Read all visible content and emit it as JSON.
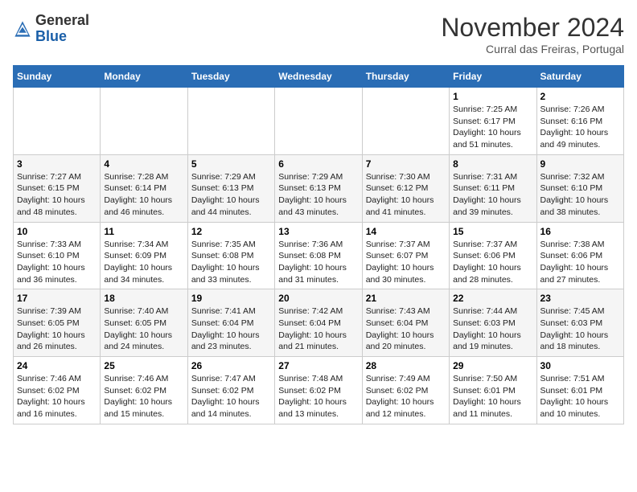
{
  "logo": {
    "general": "General",
    "blue": "Blue"
  },
  "header": {
    "month": "November 2024",
    "location": "Curral das Freiras, Portugal"
  },
  "weekdays": [
    "Sunday",
    "Monday",
    "Tuesday",
    "Wednesday",
    "Thursday",
    "Friday",
    "Saturday"
  ],
  "weeks": [
    [
      {
        "day": "",
        "info": ""
      },
      {
        "day": "",
        "info": ""
      },
      {
        "day": "",
        "info": ""
      },
      {
        "day": "",
        "info": ""
      },
      {
        "day": "",
        "info": ""
      },
      {
        "day": "1",
        "info": "Sunrise: 7:25 AM\nSunset: 6:17 PM\nDaylight: 10 hours\nand 51 minutes."
      },
      {
        "day": "2",
        "info": "Sunrise: 7:26 AM\nSunset: 6:16 PM\nDaylight: 10 hours\nand 49 minutes."
      }
    ],
    [
      {
        "day": "3",
        "info": "Sunrise: 7:27 AM\nSunset: 6:15 PM\nDaylight: 10 hours\nand 48 minutes."
      },
      {
        "day": "4",
        "info": "Sunrise: 7:28 AM\nSunset: 6:14 PM\nDaylight: 10 hours\nand 46 minutes."
      },
      {
        "day": "5",
        "info": "Sunrise: 7:29 AM\nSunset: 6:13 PM\nDaylight: 10 hours\nand 44 minutes."
      },
      {
        "day": "6",
        "info": "Sunrise: 7:29 AM\nSunset: 6:13 PM\nDaylight: 10 hours\nand 43 minutes."
      },
      {
        "day": "7",
        "info": "Sunrise: 7:30 AM\nSunset: 6:12 PM\nDaylight: 10 hours\nand 41 minutes."
      },
      {
        "day": "8",
        "info": "Sunrise: 7:31 AM\nSunset: 6:11 PM\nDaylight: 10 hours\nand 39 minutes."
      },
      {
        "day": "9",
        "info": "Sunrise: 7:32 AM\nSunset: 6:10 PM\nDaylight: 10 hours\nand 38 minutes."
      }
    ],
    [
      {
        "day": "10",
        "info": "Sunrise: 7:33 AM\nSunset: 6:10 PM\nDaylight: 10 hours\nand 36 minutes."
      },
      {
        "day": "11",
        "info": "Sunrise: 7:34 AM\nSunset: 6:09 PM\nDaylight: 10 hours\nand 34 minutes."
      },
      {
        "day": "12",
        "info": "Sunrise: 7:35 AM\nSunset: 6:08 PM\nDaylight: 10 hours\nand 33 minutes."
      },
      {
        "day": "13",
        "info": "Sunrise: 7:36 AM\nSunset: 6:08 PM\nDaylight: 10 hours\nand 31 minutes."
      },
      {
        "day": "14",
        "info": "Sunrise: 7:37 AM\nSunset: 6:07 PM\nDaylight: 10 hours\nand 30 minutes."
      },
      {
        "day": "15",
        "info": "Sunrise: 7:37 AM\nSunset: 6:06 PM\nDaylight: 10 hours\nand 28 minutes."
      },
      {
        "day": "16",
        "info": "Sunrise: 7:38 AM\nSunset: 6:06 PM\nDaylight: 10 hours\nand 27 minutes."
      }
    ],
    [
      {
        "day": "17",
        "info": "Sunrise: 7:39 AM\nSunset: 6:05 PM\nDaylight: 10 hours\nand 26 minutes."
      },
      {
        "day": "18",
        "info": "Sunrise: 7:40 AM\nSunset: 6:05 PM\nDaylight: 10 hours\nand 24 minutes."
      },
      {
        "day": "19",
        "info": "Sunrise: 7:41 AM\nSunset: 6:04 PM\nDaylight: 10 hours\nand 23 minutes."
      },
      {
        "day": "20",
        "info": "Sunrise: 7:42 AM\nSunset: 6:04 PM\nDaylight: 10 hours\nand 21 minutes."
      },
      {
        "day": "21",
        "info": "Sunrise: 7:43 AM\nSunset: 6:04 PM\nDaylight: 10 hours\nand 20 minutes."
      },
      {
        "day": "22",
        "info": "Sunrise: 7:44 AM\nSunset: 6:03 PM\nDaylight: 10 hours\nand 19 minutes."
      },
      {
        "day": "23",
        "info": "Sunrise: 7:45 AM\nSunset: 6:03 PM\nDaylight: 10 hours\nand 18 minutes."
      }
    ],
    [
      {
        "day": "24",
        "info": "Sunrise: 7:46 AM\nSunset: 6:02 PM\nDaylight: 10 hours\nand 16 minutes."
      },
      {
        "day": "25",
        "info": "Sunrise: 7:46 AM\nSunset: 6:02 PM\nDaylight: 10 hours\nand 15 minutes."
      },
      {
        "day": "26",
        "info": "Sunrise: 7:47 AM\nSunset: 6:02 PM\nDaylight: 10 hours\nand 14 minutes."
      },
      {
        "day": "27",
        "info": "Sunrise: 7:48 AM\nSunset: 6:02 PM\nDaylight: 10 hours\nand 13 minutes."
      },
      {
        "day": "28",
        "info": "Sunrise: 7:49 AM\nSunset: 6:02 PM\nDaylight: 10 hours\nand 12 minutes."
      },
      {
        "day": "29",
        "info": "Sunrise: 7:50 AM\nSunset: 6:01 PM\nDaylight: 10 hours\nand 11 minutes."
      },
      {
        "day": "30",
        "info": "Sunrise: 7:51 AM\nSunset: 6:01 PM\nDaylight: 10 hours\nand 10 minutes."
      }
    ]
  ]
}
